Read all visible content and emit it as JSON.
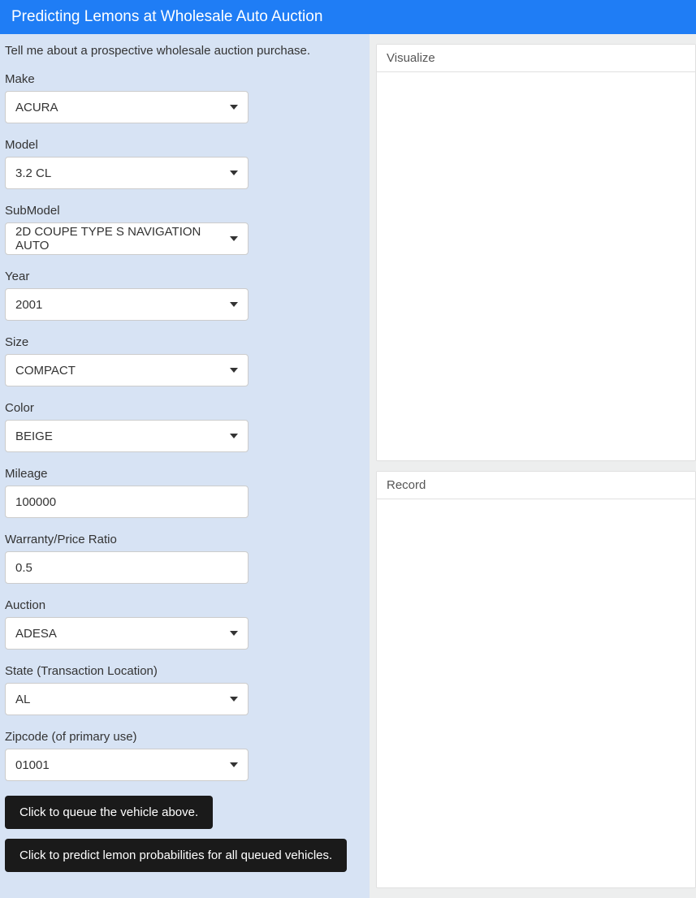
{
  "header": {
    "title": "Predicting Lemons at Wholesale Auto Auction"
  },
  "intro": "Tell me about a prospective wholesale auction purchase.",
  "fields": {
    "make": {
      "label": "Make",
      "value": "ACURA"
    },
    "model": {
      "label": "Model",
      "value": "3.2 CL"
    },
    "submodel": {
      "label": "SubModel",
      "value": "2D COUPE TYPE S NAVIGATION AUTO"
    },
    "year": {
      "label": "Year",
      "value": "2001"
    },
    "size": {
      "label": "Size",
      "value": "COMPACT"
    },
    "color": {
      "label": "Color",
      "value": "BEIGE"
    },
    "mileage": {
      "label": "Mileage",
      "value": "100000"
    },
    "ratio": {
      "label": "Warranty/Price Ratio",
      "value": "0.5"
    },
    "auction": {
      "label": "Auction",
      "value": "ADESA"
    },
    "state": {
      "label": "State (Transaction Location)",
      "value": "AL"
    },
    "zipcode": {
      "label": "Zipcode (of primary use)",
      "value": "01001"
    }
  },
  "buttons": {
    "queue": "Click to queue the vehicle above.",
    "predict": "Click to predict lemon probabilities for all queued vehicles."
  },
  "panels": {
    "visualize": "Visualize",
    "record": "Record"
  }
}
